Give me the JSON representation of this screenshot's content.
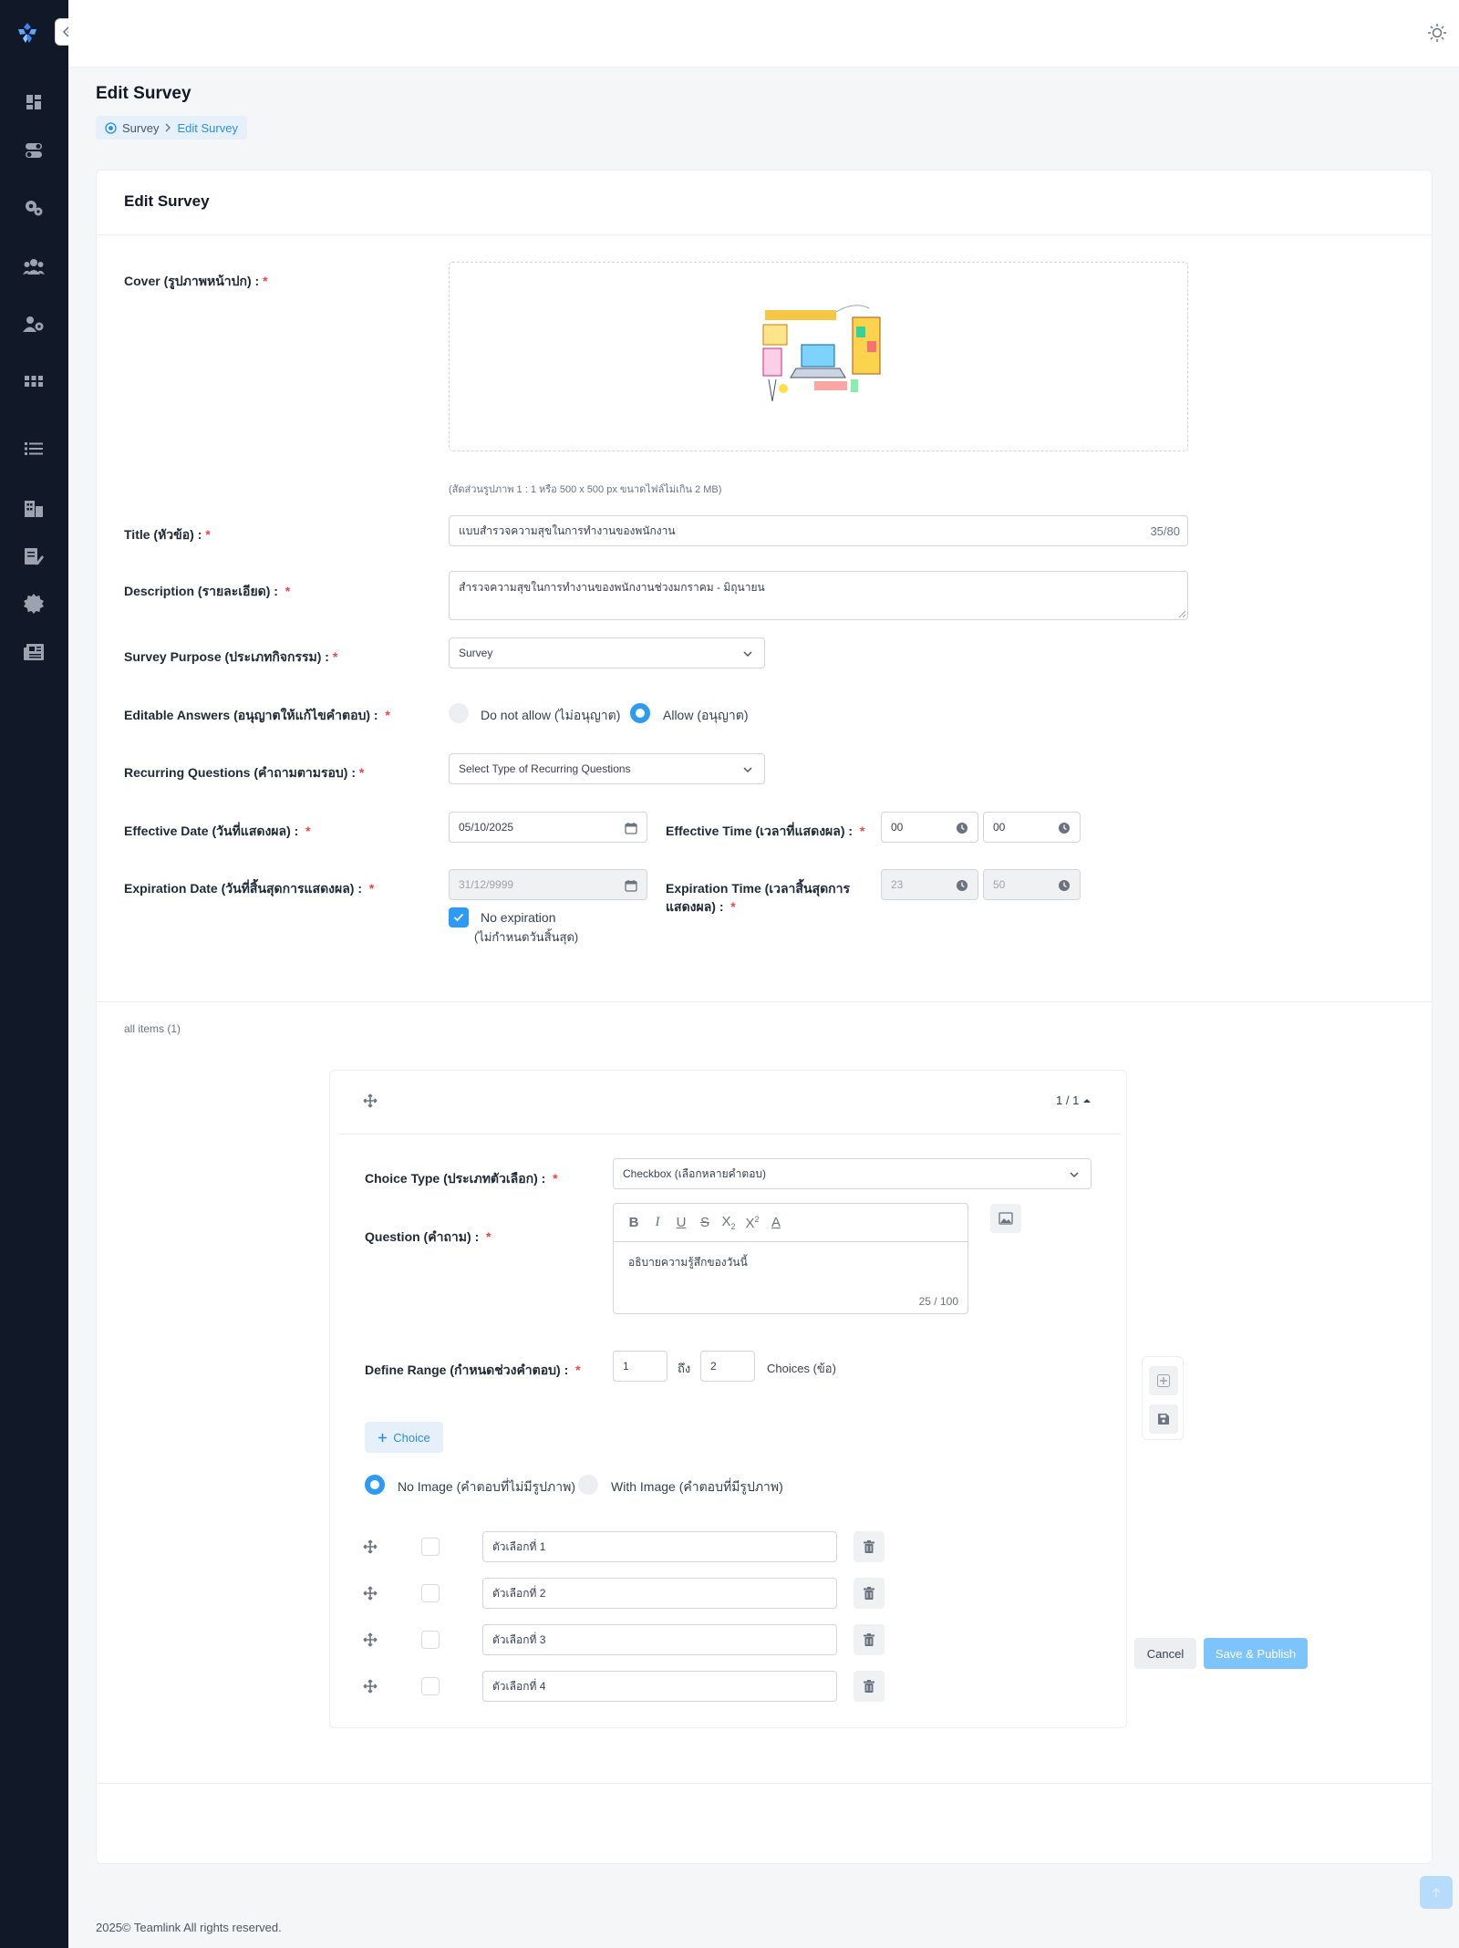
{
  "page": {
    "title": "Edit Survey",
    "breadcrumb": [
      "Survey",
      "Edit Survey"
    ]
  },
  "card": {
    "title": "Edit Survey"
  },
  "form": {
    "cover_label": "Cover (รูปภาพหน้าปก) :",
    "cover_hint": "(สัดส่วนรูปภาพ 1 : 1 หรือ 500 x 500 px ขนาดไฟล์ไม่เกิน 2 MB)",
    "title_label": "Title (หัวข้อ) :",
    "title_value": "แบบสำรวจความสุขในการทำงานของพนักงาน",
    "title_counter": "35/80",
    "description_label": "Description (รายละเอียด) :",
    "description_value": "สำรวจความสุขในการทำงานของพนักงานช่วงมกราคม - มิถุนายน",
    "purpose_label": "Survey Purpose (ประเภทกิจกรรม) :",
    "purpose_value": "Survey",
    "editable_label": "Editable Answers (อนุญาตให้แก้ไขคำตอบ) :",
    "editable_options": [
      "Do not allow (ไม่อนุญาต)",
      "Allow (อนุญาต)"
    ],
    "editable_selected": "Allow (อนุญาต)",
    "recurring_label": "Recurring Questions (คำถามตามรอบ) :",
    "recurring_placeholder": "Select Type of Recurring Questions",
    "effective_date_label": "Effective Date (วันที่แสดงผล) :",
    "effective_date_value": "05/10/2025",
    "effective_time_label": "Effective Time (เวลาที่แสดงผล) :",
    "effective_time_hour": "00",
    "effective_time_minute": "00",
    "expiration_date_label": "Expiration Date (วันที่สิ้นสุดการแสดงผล) :",
    "expiration_date_value": "31/12/9999",
    "expiration_time_label_1": "Expiration Time (เวลาสิ้นสุดการ",
    "expiration_time_label_2": "แสดงผล) :",
    "expiration_time_hour": "23",
    "expiration_time_minute": "50",
    "no_expiration_label": "No expiration",
    "no_expiration_sub": "(ไม่กำหนดวันสิ้นสุด)",
    "required_mark": "*"
  },
  "items": {
    "all_items_label": "all items (1)",
    "pager": "1 / 1",
    "choice_type_label": "Choice Type (ประเภทตัวเลือก) :",
    "choice_type_value": "Checkbox (เลือกหลายคำตอบ)",
    "question_label": "Question (คำถาม) :",
    "question_value": "อธิบายความรู้สึกของวันนี้",
    "question_counter": "25 / 100",
    "range_label": "Define Range (กำหนดช่วงคำตอบ) :",
    "range_from": "1",
    "range_to_word": "ถึง",
    "range_to": "2",
    "range_unit": "Choices (ข้อ)",
    "add_choice_label": "Choice",
    "image_options": [
      "No Image (คำตอบที่ไม่มีรูปภาพ)",
      "With Image (คำตอบที่มีรูปภาพ)"
    ],
    "image_selected": "No Image (คำตอบที่ไม่มีรูปภาพ)",
    "choices": [
      "ตัวเลือกที่ 1",
      "ตัวเลือกที่ 2",
      "ตัวเลือกที่ 3",
      "ตัวเลือกที่ 4"
    ]
  },
  "actions": {
    "cancel": "Cancel",
    "save_publish": "Save & Publish"
  },
  "footer": {
    "text": "2025© Teamlink All rights reserved."
  },
  "colors": {
    "sidebar": "#111827",
    "primary": "#2b9bf4",
    "required": "#ef4444"
  }
}
